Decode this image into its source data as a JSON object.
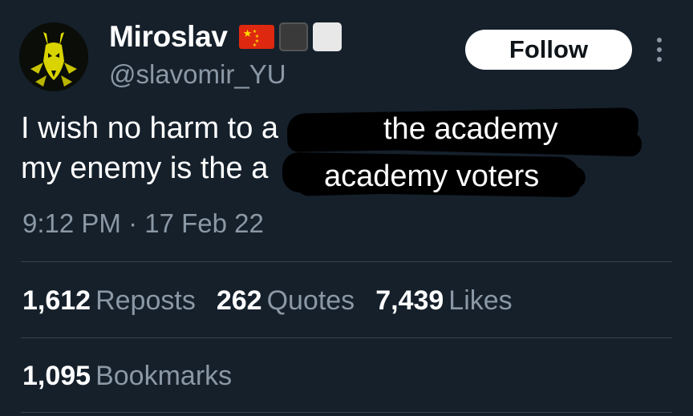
{
  "author": {
    "display_name": "Miroslav",
    "handle": "@slavomir_YU",
    "badges": [
      "china-flag-emoji",
      "black-square-emoji",
      "white-square-emoji"
    ]
  },
  "follow_button": {
    "label": "Follow"
  },
  "more_menu": {
    "icon": "more-vertical-icon"
  },
  "tweet": {
    "line1_visible": "I wish no harm to a",
    "line2_visible": "my enemy is the a",
    "overlay1": "the academy",
    "overlay2": "academy voters"
  },
  "timestamp": "9:12 PM · 17 Feb 22",
  "stats": {
    "reposts": {
      "count": "1,612",
      "label": "Reposts"
    },
    "quotes": {
      "count": "262",
      "label": "Quotes"
    },
    "likes": {
      "count": "7,439",
      "label": "Likes"
    },
    "bookmarks": {
      "count": "1,095",
      "label": "Bookmarks"
    }
  },
  "colors": {
    "background": "#15202b",
    "secondary_text": "#8b98a5",
    "divider": "#38444d",
    "avatar_accent": "#e5e000"
  }
}
